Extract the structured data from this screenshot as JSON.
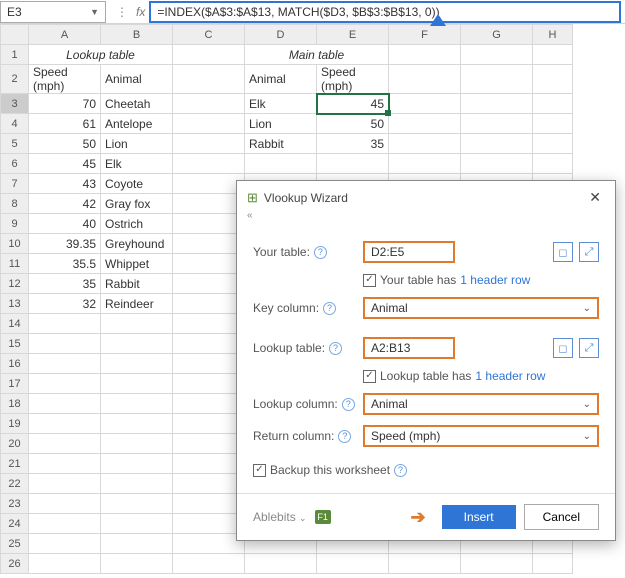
{
  "name_box": "E3",
  "fx_label": "fx",
  "formula": "=INDEX($A$3:$A$13, MATCH($D3, $B$3:$B$13, 0))",
  "columns": [
    "A",
    "B",
    "C",
    "D",
    "E",
    "F",
    "G",
    "H"
  ],
  "rows": [
    "1",
    "2",
    "3",
    "4",
    "5",
    "6",
    "7",
    "8",
    "9",
    "10",
    "11",
    "12",
    "13",
    "14",
    "15",
    "16",
    "17",
    "18",
    "19",
    "20",
    "21",
    "22",
    "23",
    "24",
    "25",
    "26"
  ],
  "lookup_title": "Lookup table",
  "main_title": "Main table",
  "lookup_headers": {
    "a": "Speed (mph)",
    "b": "Animal"
  },
  "main_headers": {
    "d": "Animal",
    "e": "Speed (mph)"
  },
  "lookup_rows": [
    {
      "s": "70",
      "a": "Cheetah"
    },
    {
      "s": "61",
      "a": "Antelope"
    },
    {
      "s": "50",
      "a": "Lion"
    },
    {
      "s": "45",
      "a": "Elk"
    },
    {
      "s": "43",
      "a": "Coyote"
    },
    {
      "s": "42",
      "a": "Gray fox"
    },
    {
      "s": "40",
      "a": "Ostrich"
    },
    {
      "s": "39.35",
      "a": "Greyhound"
    },
    {
      "s": "35.5",
      "a": "Whippet"
    },
    {
      "s": "35",
      "a": "Rabbit"
    },
    {
      "s": "32",
      "a": "Reindeer"
    }
  ],
  "main_rows": [
    {
      "a": "Elk",
      "s": "45"
    },
    {
      "a": "Lion",
      "s": "50"
    },
    {
      "a": "Rabbit",
      "s": "35"
    }
  ],
  "dialog": {
    "title": "Vlookup Wizard",
    "your_table_lbl": "Your table:",
    "your_table_val": "D2:E5",
    "your_table_chk": "Your table has",
    "header_link": "1 header row",
    "key_col_lbl": "Key column:",
    "key_col_val": "Animal",
    "lookup_tbl_lbl": "Lookup table:",
    "lookup_tbl_val": "A2:B13",
    "lookup_tbl_chk": "Lookup table has",
    "lookup_col_lbl": "Lookup column:",
    "lookup_col_val": "Animal",
    "return_col_lbl": "Return column:",
    "return_col_val": "Speed (mph)",
    "backup_lbl": "Backup this worksheet",
    "brand": "Ablebits",
    "f1": "F1",
    "insert": "Insert",
    "cancel": "Cancel"
  }
}
